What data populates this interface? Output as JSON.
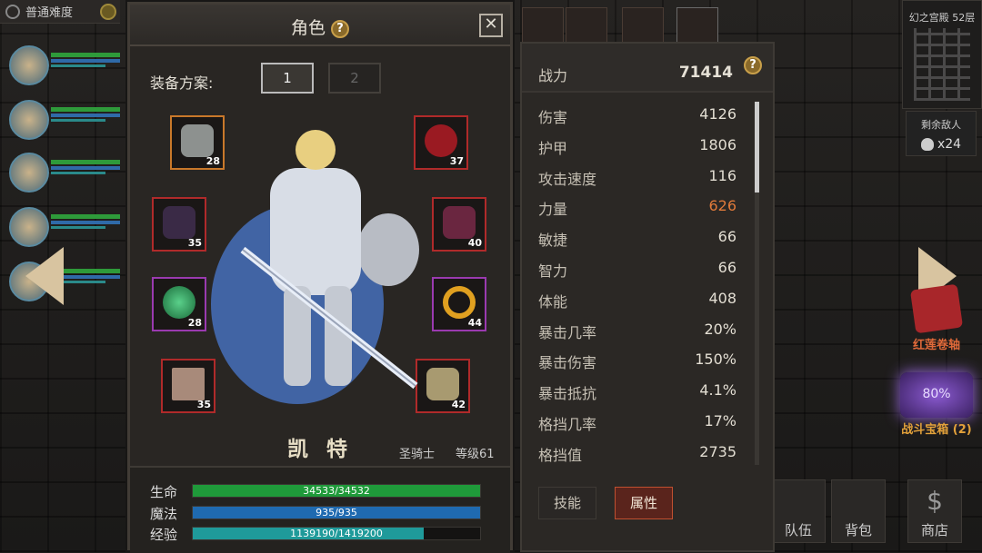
{
  "difficulty": "普通难度",
  "dungeon": {
    "floor_label": "幻之宫殿 52层",
    "enemies_label": "剩余敌人",
    "enemies_count": "x24"
  },
  "side_items": {
    "scroll_label": "红莲卷轴",
    "chest_label": "战斗宝箱 (2)",
    "chest_progress": "80%"
  },
  "bottom_nav": {
    "team": "队伍",
    "bag": "背包",
    "shop": "商店",
    "shop_icon": "$"
  },
  "panel": {
    "title": "角色",
    "help": "?",
    "close": "✕",
    "loadout_label": "装备方案:",
    "loadouts": [
      "1",
      "2"
    ],
    "slots": [
      {
        "name": "helmet",
        "level": "28",
        "color": "#c9782a"
      },
      {
        "name": "amulet",
        "level": "37",
        "color": "#b02a2a"
      },
      {
        "name": "armor",
        "level": "35",
        "color": "#b02a2a"
      },
      {
        "name": "gauntlet",
        "level": "40",
        "color": "#b02a2a"
      },
      {
        "name": "ring-green",
        "level": "28",
        "color": "#9a3ab0"
      },
      {
        "name": "ring-gold",
        "level": "44",
        "color": "#9a3ab0"
      },
      {
        "name": "hammer",
        "level": "35",
        "color": "#b02a2a"
      },
      {
        "name": "boots",
        "level": "42",
        "color": "#b02a2a"
      }
    ],
    "hero_name": "凯 特",
    "hero_class": "圣骑士",
    "hero_level": "等级61",
    "bars": {
      "hp": {
        "label": "生命",
        "text": "34533/34532",
        "fill": 1.0,
        "color": "#1f9a3a"
      },
      "mp": {
        "label": "魔法",
        "text": "935/935",
        "fill": 1.0,
        "color": "#1f6ab0"
      },
      "xp": {
        "label": "经验",
        "text": "1139190/1419200",
        "fill": 0.8027,
        "color": "#1f9a9a"
      }
    }
  },
  "stats": {
    "power_label": "战力",
    "power_value": "71414",
    "help": "?",
    "rows": [
      {
        "label": "伤害",
        "value": "4126"
      },
      {
        "label": "护甲",
        "value": "1806"
      },
      {
        "label": "攻击速度",
        "value": "116"
      },
      {
        "label": "力量",
        "value": "626"
      },
      {
        "label": "敏捷",
        "value": "66"
      },
      {
        "label": "智力",
        "value": "66"
      },
      {
        "label": "体能",
        "value": "408"
      },
      {
        "label": "暴击几率",
        "value": "20%"
      },
      {
        "label": "暴击伤害",
        "value": "150%"
      },
      {
        "label": "暴击抵抗",
        "value": "4.1%"
      },
      {
        "label": "格挡几率",
        "value": "17%"
      },
      {
        "label": "格挡值",
        "value": "2735"
      }
    ],
    "tabs": {
      "skills": "技能",
      "attributes": "属性"
    }
  }
}
